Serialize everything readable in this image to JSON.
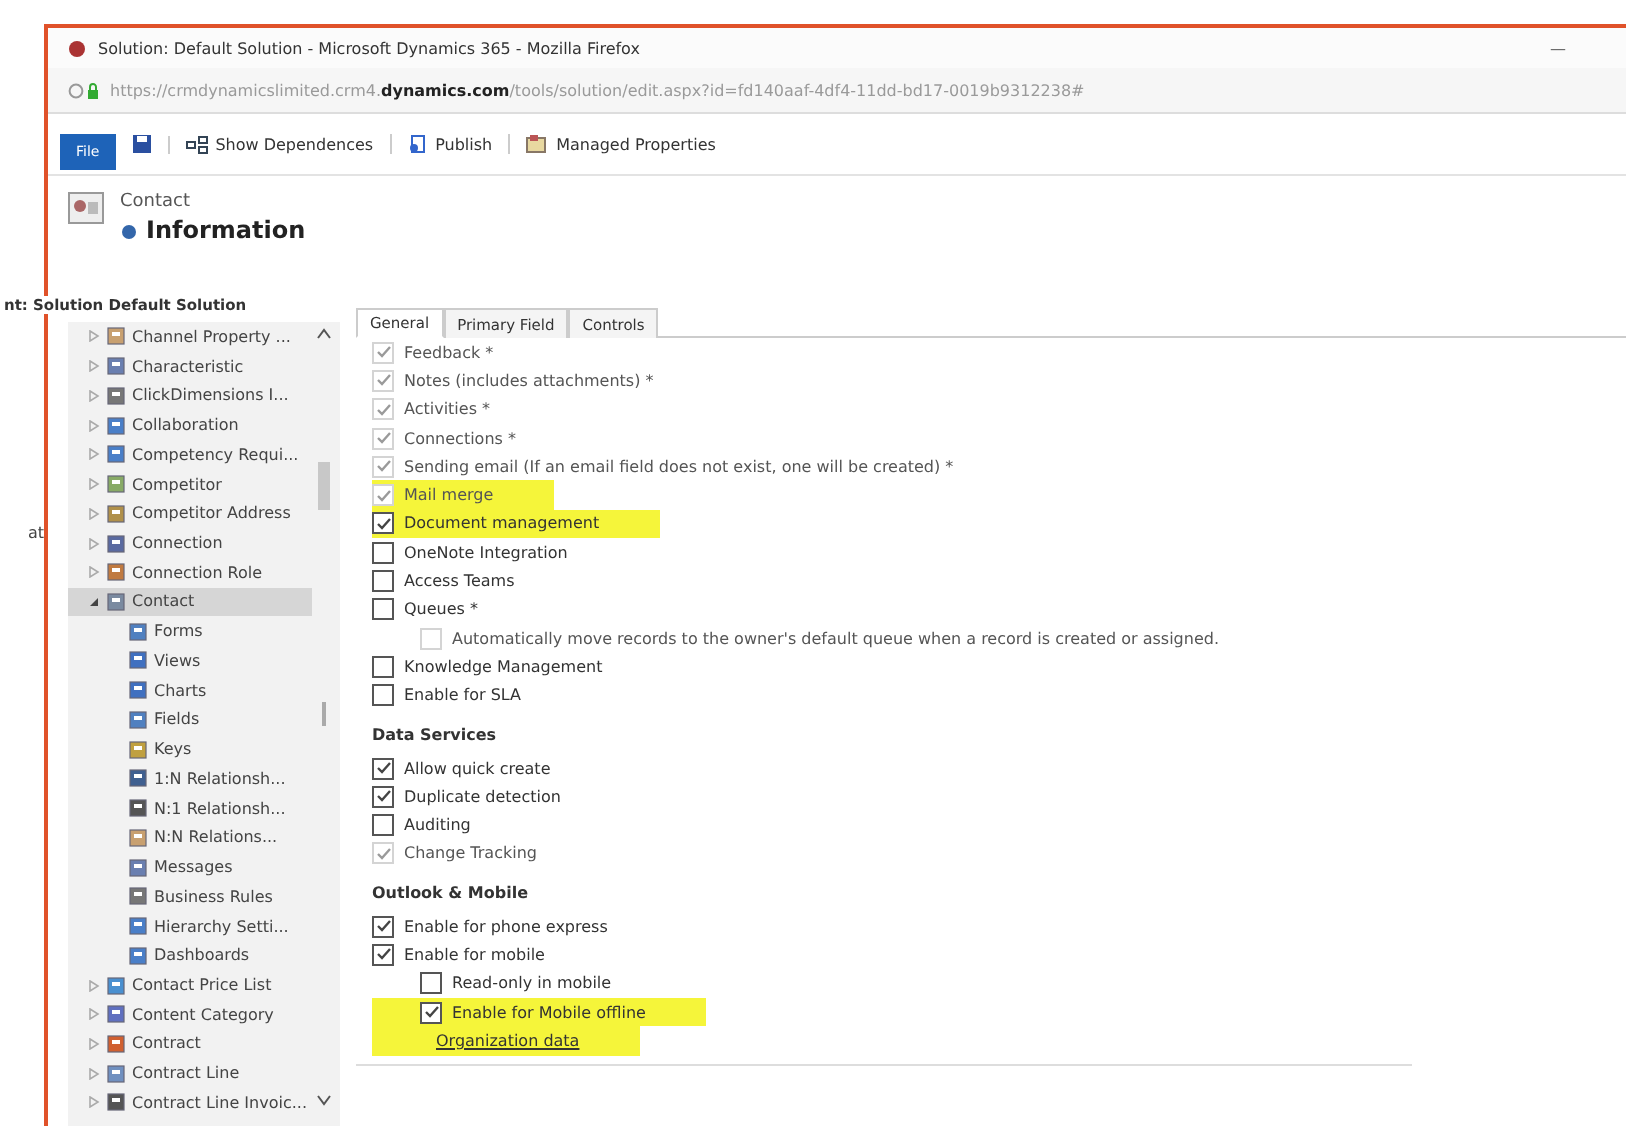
{
  "window": {
    "title": "Solution: Default Solution - Microsoft Dynamics 365 - Mozilla Firefox",
    "minimize": "—"
  },
  "address_bar": {
    "url": "https://crmdynamicslimited.crm4.**dynamics.com**/tools/solution/edit.aspx?id=fd140aaf-4df4-11dd-bd17-0019b9312238#"
  },
  "toolbar": {
    "file": "File",
    "buttons": [
      {
        "kind": "dependencies",
        "label": "Show Dependences"
      },
      {
        "kind": "publish",
        "label": "Publish"
      },
      {
        "kind": "properties",
        "label": "Managed Properties"
      }
    ]
  },
  "side_fragments": [
    "at"
  ],
  "header": {
    "entity": "Contact",
    "title": "Information"
  },
  "tree": {
    "title": "nt: Solution Default Solution",
    "items": [
      {
        "label": "Channel Property ...",
        "selected": false,
        "expanded": false
      },
      {
        "label": "Characteristic",
        "selected": false,
        "expanded": false
      },
      {
        "label": "ClickDimensions I...",
        "selected": false,
        "expanded": false
      },
      {
        "label": "Collaboration",
        "selected": false,
        "expanded": false
      },
      {
        "label": "Competency Requi...",
        "selected": false,
        "expanded": false
      },
      {
        "label": "Competitor",
        "selected": false,
        "expanded": false
      },
      {
        "label": "Competitor Address",
        "selected": false,
        "expanded": false
      },
      {
        "label": "Connection",
        "selected": false,
        "expanded": false
      },
      {
        "label": "Connection Role",
        "selected": false,
        "expanded": false
      },
      {
        "label": "Contact",
        "selected": true,
        "expanded": true,
        "children": [
          {
            "label": "Forms",
            "selected": false
          },
          {
            "label": "Views",
            "selected": false
          },
          {
            "label": "Charts",
            "selected": false
          },
          {
            "label": "Fields",
            "selected": false
          },
          {
            "label": "Keys",
            "selected": false
          },
          {
            "label": "1:N Relationsh...",
            "selected": false
          },
          {
            "label": "N:1 Relationsh...",
            "selected": false
          },
          {
            "label": "N:N Relations...",
            "selected": false
          },
          {
            "label": "Messages",
            "selected": false
          },
          {
            "label": "Business Rules",
            "selected": false
          },
          {
            "label": "Hierarchy Setti...",
            "selected": false
          },
          {
            "label": "Dashboards",
            "selected": false
          }
        ]
      },
      {
        "label": "Contact Price List",
        "selected": false,
        "expanded": false
      },
      {
        "label": "Content Category",
        "selected": false,
        "expanded": false
      },
      {
        "label": "Contract",
        "selected": false,
        "expanded": false
      },
      {
        "label": "Contract Line",
        "selected": false,
        "expanded": false
      },
      {
        "label": "Contract Line Invoic...",
        "selected": false,
        "expanded": false
      }
    ]
  },
  "tabs": [
    {
      "label": "General",
      "selected": true
    },
    {
      "label": "Primary Field",
      "selected": false
    },
    {
      "label": "Controls",
      "selected": false
    }
  ],
  "sections": [
    {
      "items": [
        {
          "kind": "checkbox",
          "label": "Feedback *",
          "checked": true,
          "disabled": true,
          "highlighted": false
        },
        {
          "kind": "checkbox",
          "label": "Notes (includes attachments) *",
          "checked": true,
          "disabled": true,
          "highlighted": false
        },
        {
          "kind": "checkbox",
          "label": "Activities *",
          "checked": true,
          "disabled": true,
          "highlighted": false
        },
        {
          "kind": "checkbox",
          "label": "Connections *",
          "checked": true,
          "disabled": true,
          "highlighted": false
        },
        {
          "kind": "checkbox",
          "label": "Sending email (If an email field does not exist, one will be created) *",
          "checked": true,
          "disabled": true,
          "highlighted": false
        },
        {
          "kind": "checkbox",
          "label": "Mail merge",
          "checked": true,
          "disabled": true,
          "highlighted": true
        },
        {
          "kind": "checkbox",
          "label": "Document management",
          "checked": true,
          "disabled": false,
          "highlighted": true
        },
        {
          "kind": "checkbox",
          "label": "OneNote Integration",
          "checked": false,
          "disabled": false,
          "highlighted": false
        },
        {
          "kind": "checkbox",
          "label": "Access Teams",
          "checked": false,
          "disabled": false,
          "highlighted": false
        },
        {
          "kind": "checkbox",
          "label": "Queues *",
          "checked": false,
          "disabled": false,
          "highlighted": false,
          "children": [
            {
              "kind": "checkbox",
              "label": "Automatically move records to the owner's default queue when a record is created or assigned.",
              "checked": false,
              "disabled": true,
              "highlighted": false
            }
          ]
        },
        {
          "kind": "checkbox",
          "label": "Knowledge Management",
          "checked": false,
          "disabled": false,
          "highlighted": false
        },
        {
          "kind": "checkbox",
          "label": "Enable for SLA",
          "checked": false,
          "disabled": false,
          "highlighted": false
        }
      ]
    },
    {
      "heading": "Data Services",
      "items": [
        {
          "kind": "checkbox",
          "label": "Allow quick create",
          "checked": true,
          "disabled": false,
          "highlighted": false
        },
        {
          "kind": "checkbox",
          "label": "Duplicate detection",
          "checked": true,
          "disabled": false,
          "highlighted": false
        },
        {
          "kind": "checkbox",
          "label": "Auditing",
          "checked": false,
          "disabled": false,
          "highlighted": false
        },
        {
          "kind": "checkbox",
          "label": "Change Tracking",
          "checked": true,
          "disabled": true,
          "highlighted": false
        }
      ]
    },
    {
      "heading": "Outlook & Mobile",
      "items": [
        {
          "kind": "checkbox",
          "label": "Enable for phone express",
          "checked": true,
          "disabled": false,
          "highlighted": false
        },
        {
          "kind": "checkbox",
          "label": "Enable for mobile",
          "checked": true,
          "disabled": false,
          "highlighted": false,
          "children": [
            {
              "kind": "checkbox",
              "label": "Read-only in mobile",
              "checked": false,
              "disabled": false,
              "highlighted": false
            },
            {
              "kind": "checkbox",
              "label": "Enable for Mobile offline",
              "checked": true,
              "disabled": false,
              "highlighted": true
            },
            {
              "kind": "link",
              "label": "Organization data",
              "highlighted": true
            }
          ]
        }
      ]
    }
  ]
}
